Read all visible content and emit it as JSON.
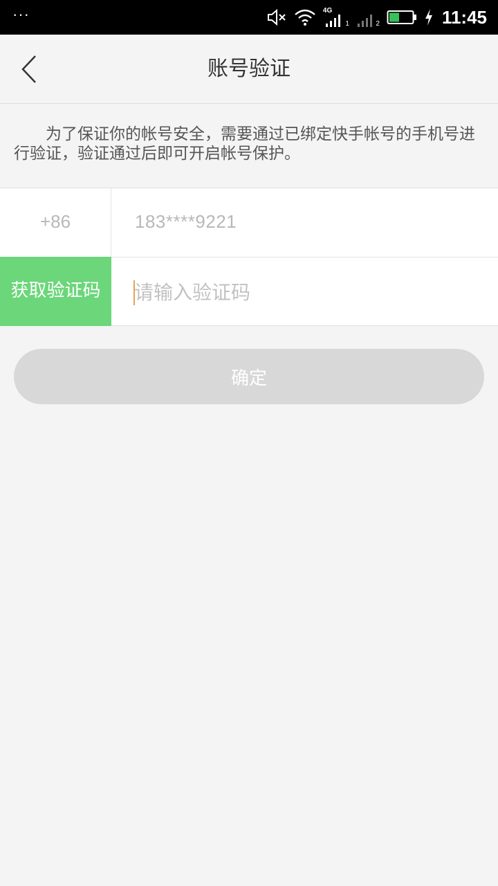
{
  "status_bar": {
    "menu_dots": "···",
    "network_label": "4G",
    "sim1_label": "1",
    "sim2_label": "2",
    "time": "11:45",
    "icons": [
      "mute-icon",
      "wifi-icon",
      "signal-sim1-icon",
      "signal-sim2-icon",
      "battery-icon",
      "charging-icon"
    ]
  },
  "header": {
    "title": "账号验证",
    "back_icon": "chevron-left-icon"
  },
  "description": "为了保证你的帐号安全，需要通过已绑定快手帐号的手机号进行验证，验证通过后即可开启帐号保护。",
  "form": {
    "country_code": "+86",
    "phone_masked": "183****9221",
    "get_code_label": "获取验证码",
    "code_placeholder": "请输入验证码",
    "code_value": ""
  },
  "confirm_label": "确定",
  "colors": {
    "accent_green": "#6bd67a",
    "button_disabled": "#d8d8d8",
    "background": "#f4f4f4",
    "caret": "#e0a25a"
  }
}
